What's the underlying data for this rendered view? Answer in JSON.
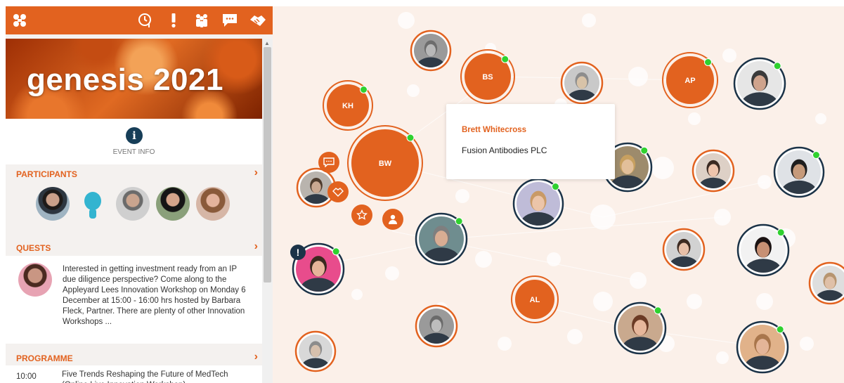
{
  "colors": {
    "accent": "#e2621f",
    "navy": "#1b3348",
    "online": "#2fd12f",
    "network_bg": "#fbf0e9"
  },
  "topbar": {
    "logo_icon": "genesis-logo-icon",
    "icons": [
      "clock-icon",
      "exclamation-icon",
      "people-icon",
      "chat-icon",
      "handshake-icon"
    ]
  },
  "banner": {
    "title": "genesis 2021"
  },
  "event_info": {
    "label": "EVENT INFO",
    "icon": "info-icon"
  },
  "participants": {
    "title": "PARTICIPANTS",
    "chevron": "›"
  },
  "quests": {
    "title": "QUESTS",
    "chevron": "›",
    "text": "Interested in getting investment ready from an IP due diligence perspective? Come along to the Appleyard Lees Innovation Workshop on Monday 6 December at 15:00 - 16:00 hrs hosted by Barbara Fleck, Partner. There are plenty of other Innovation Workshops ..."
  },
  "programme": {
    "title": "PROGRAMME",
    "chevron": "›",
    "time": "10:00",
    "item_title": "Five Trends Reshaping the Future of MedTech (Online Live Innovation Workshop)"
  },
  "card": {
    "name": "Brett Whitecross",
    "org": "Fusion Antibodies PLC"
  },
  "initial_nodes": {
    "KH": "KH",
    "BS": "BS",
    "AP": "AP",
    "BW": "BW",
    "AL": "AL"
  },
  "hub_actions": [
    "chat-icon",
    "handshake-icon",
    "star-icon",
    "user-icon"
  ],
  "alert": "!"
}
